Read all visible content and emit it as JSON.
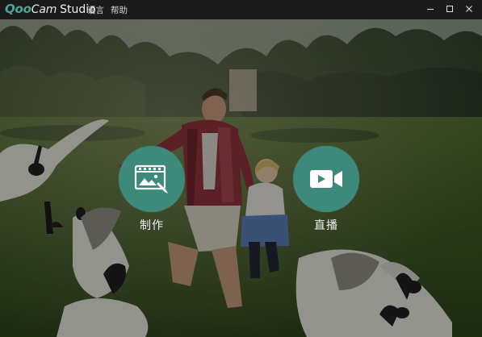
{
  "app": {
    "brand_prefix": "Qoo",
    "brand_suffix": "Cam",
    "product": "Studio"
  },
  "menu": {
    "language": "语言",
    "help": "帮助"
  },
  "actions": {
    "edit": {
      "label": "制作",
      "icon": "video-editing-icon"
    },
    "live": {
      "label": "直播",
      "icon": "video-camera-icon"
    }
  },
  "colors": {
    "accent": "#3d8a7c",
    "titlebar": "#1b1b1b",
    "logo_q": "#4aa59b"
  },
  "window_controls": [
    "minimize-icon",
    "maximize-icon",
    "close-icon"
  ],
  "background": "photo of a man and a child running in a park with geese"
}
